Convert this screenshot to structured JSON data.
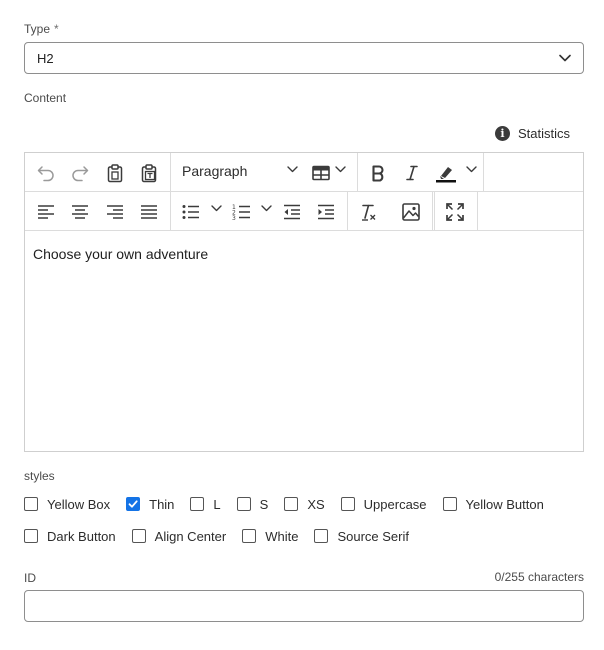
{
  "type_field": {
    "label": "Type",
    "required_mark": "*",
    "selected": "H2"
  },
  "content_field": {
    "label": "Content"
  },
  "statistics": {
    "icon": "info-icon",
    "label": "Statistics",
    "icon_glyph": "i"
  },
  "editor": {
    "block_format": "Paragraph",
    "text": "Choose your own adventure",
    "toolbar": {
      "row1": [
        "undo-icon",
        "redo-icon",
        "paste-icon",
        "paste-as-text-icon",
        "block-format-dropdown",
        "table-icon",
        "bold-icon",
        "italic-icon",
        "highlight-icon"
      ],
      "row2": [
        "align-left-icon",
        "align-center-icon",
        "align-right-icon",
        "justify-icon",
        "bulleted-list-icon",
        "numbered-list-icon",
        "outdent-icon",
        "indent-icon",
        "remove-format-icon",
        "insert-image-icon",
        "fullscreen-icon"
      ]
    },
    "colors": {
      "icon": "#3b3b3b",
      "disabled_icon": "#9a9a9a",
      "border": "#cfcfcf"
    }
  },
  "styles_field": {
    "label": "styles",
    "row1": [
      {
        "label": "Yellow Box",
        "checked": false
      },
      {
        "label": "Thin",
        "checked": true
      },
      {
        "label": "L",
        "checked": false
      },
      {
        "label": "S",
        "checked": false
      },
      {
        "label": "XS",
        "checked": false
      },
      {
        "label": "Uppercase",
        "checked": false
      },
      {
        "label": "Yellow Button",
        "checked": false
      }
    ],
    "row2": [
      {
        "label": "Dark Button",
        "checked": false
      },
      {
        "label": "Align Center",
        "checked": false
      },
      {
        "label": "White",
        "checked": false
      },
      {
        "label": "Source Serif",
        "checked": false
      }
    ],
    "check_color": "#1473e6"
  },
  "id_field": {
    "label": "ID",
    "counter": "0/255 characters",
    "value": ""
  }
}
